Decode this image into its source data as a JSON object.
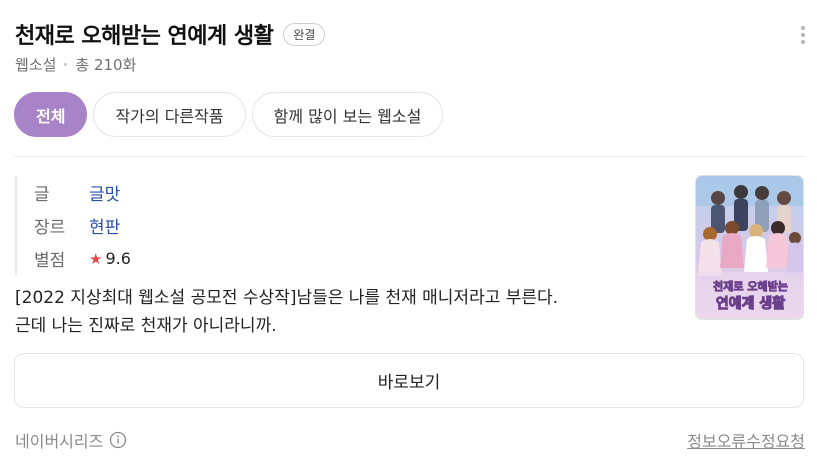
{
  "header": {
    "title": "천재로 오해받는 연예계 생활",
    "status_badge": "완결",
    "category": "웹소설",
    "episode_count": "총 210화"
  },
  "tabs": [
    {
      "label": "전체",
      "active": true
    },
    {
      "label": "작가의 다른작품",
      "active": false
    },
    {
      "label": "함께 많이 보는 웹소설",
      "active": false
    }
  ],
  "info": {
    "author_label": "글",
    "author_value": "글맛",
    "genre_label": "장르",
    "genre_value": "현판",
    "rating_label": "별점",
    "rating_star": "★",
    "rating_value": "9.6"
  },
  "description": {
    "line1": "[2022 지상최대 웹소설 공모전 수상작]남들은 나를 천재 매니저라고 부른다.",
    "line2": "근데 나는 진짜로 천재가 아니라니까."
  },
  "cover": {
    "title_line1": "천재로 오해받는",
    "title_line2": "연예계 생활"
  },
  "actions": {
    "view_button": "바로보기"
  },
  "footer": {
    "source": "네이버시리즈",
    "report_link": "정보오류수정요청"
  },
  "colors": {
    "accent": "#a883c8",
    "link": "#2c4fa8",
    "star": "#e24b4b"
  }
}
